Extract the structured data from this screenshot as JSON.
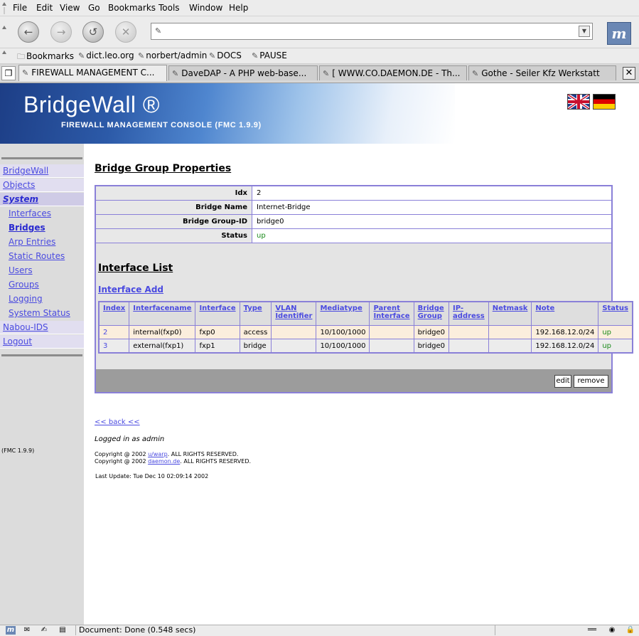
{
  "browser": {
    "menu": [
      "File",
      "Edit",
      "View",
      "Go",
      "Bookmarks",
      "Tools",
      "Window",
      "Help"
    ],
    "url": "",
    "bookmarks": [
      "Bookmarks",
      "dict.leo.org",
      "norbert/admin",
      "DOCS",
      "PAUSE"
    ],
    "tabs": [
      "FIREWALL MANAGEMENT C...",
      "DaveDAP - A PHP web-base...",
      "[ WWW.CO.DAEMON.DE - Th...",
      "Gothe - Seiler Kfz Werkstatt"
    ],
    "status": "Document: Done (0.548 secs)"
  },
  "banner": {
    "title": "BridgeWall ®",
    "subtitle": "FIREWALL MANAGEMENT CONSOLE (FMC 1.9.9)"
  },
  "sidebar": {
    "items": [
      {
        "label": "BridgeWall"
      },
      {
        "label": "Objects"
      },
      {
        "label": "System"
      },
      {
        "label": "Interfaces"
      },
      {
        "label": "Bridges"
      },
      {
        "label": "Arp Entries"
      },
      {
        "label": "Static Routes"
      },
      {
        "label": "Users"
      },
      {
        "label": "Groups"
      },
      {
        "label": "Logging"
      },
      {
        "label": "System Status"
      },
      {
        "label": "Nabou-IDS"
      },
      {
        "label": "Logout"
      }
    ],
    "version": "(FMC 1.9.9)"
  },
  "main": {
    "title": "Bridge Group Properties",
    "props": [
      {
        "key": "Idx",
        "value": "2"
      },
      {
        "key": "Bridge Name",
        "value": "Internet-Bridge"
      },
      {
        "key": "Bridge Group-ID",
        "value": "bridge0"
      },
      {
        "key": "Status",
        "value": "up"
      }
    ],
    "interface_list_title": "Interface List",
    "interface_add": "Interface Add",
    "columns": [
      "Index",
      "Interfacename",
      "Interface",
      "Type",
      "VLAN Identifier",
      "Mediatype",
      "Parent Interface",
      "Bridge Group",
      "IP-address",
      "Netmask",
      "Note",
      "Status"
    ],
    "rows": [
      [
        "2",
        "internal(fxp0)",
        "fxp0",
        "access",
        "",
        "10/100/1000",
        "",
        "bridge0",
        "",
        "",
        "192.168.12.0/24",
        "up"
      ],
      [
        "3",
        "external(fxp1)",
        "fxp1",
        "bridge",
        "",
        "10/100/1000",
        "",
        "bridge0",
        "",
        "",
        "192.168.12.0/24",
        "up"
      ]
    ],
    "edit_label": "edit",
    "remove_label": "remove"
  },
  "footer": {
    "back": "<< back <<",
    "logged_in": "Logged in as admin",
    "copy1_pre": "Copyright @ 2002 ",
    "copy1_link": "u/warp",
    "copy1_post": ". ALL RIGHTS RESERVED.",
    "copy2_pre": "Copyright @ 2002 ",
    "copy2_link": "daemon.de",
    "copy2_post": ". ALL RIGHTS RESERVED.",
    "last_update": "Last Update: Tue Dec 10 02:09:14 2002"
  },
  "colors": {
    "accent_border": "#8a80d8",
    "link": "#4a4ae0",
    "status_up": "#1a8a1a"
  }
}
